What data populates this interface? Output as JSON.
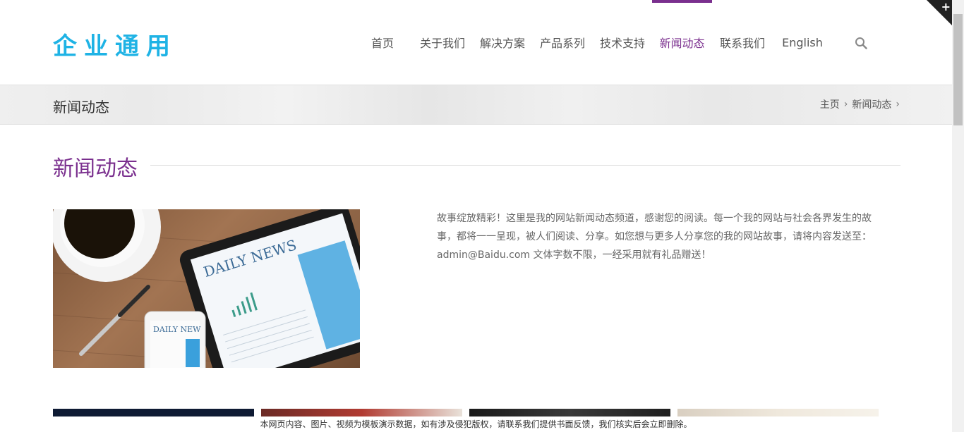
{
  "header": {
    "logo": "企业通用",
    "nav": [
      {
        "label": "首页"
      },
      {
        "label": "关于我们"
      },
      {
        "label": "解决方案"
      },
      {
        "label": "产品系列"
      },
      {
        "label": "技术支持"
      },
      {
        "label": "新闻动态",
        "active": true
      },
      {
        "label": "联系我们"
      },
      {
        "label": "English"
      }
    ],
    "search_icon": "search-icon"
  },
  "banner": {
    "title": "新闻动态",
    "breadcrumb": [
      "主页",
      "新闻动态"
    ]
  },
  "section": {
    "title": "新闻动态",
    "intro": "故事绽放精彩！这里是我的网站新闻动态频道，感谢您的阅读。每一个我的网站与社会各界发生的故事，都将一一呈现，被人们阅读、分享。如您想与更多人分享您的我的网站故事，请将内容发送至：admin@Baidu.com 文体字数不限，一经采用就有礼品赠送！",
    "feature_image": {
      "tablet_text": "DAILY NEWS",
      "phone_text": "DAILY NEW"
    }
  },
  "notice": "本网页内容、图片、视频为模板演示数据，如有涉及侵犯版权，请联系我们提供书面反馈，我们核实后会立即删除。",
  "colors": {
    "accent": "#7a2f8e",
    "logo": "#1fb3e5"
  }
}
